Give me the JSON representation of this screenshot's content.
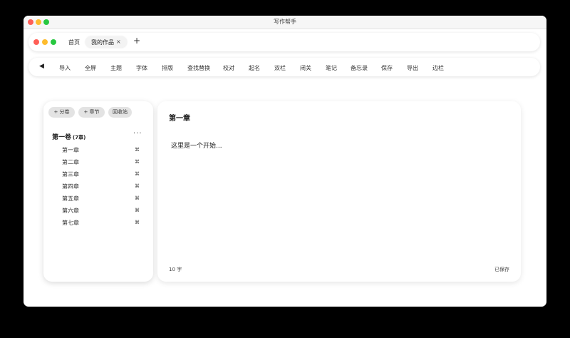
{
  "window": {
    "title": "写作帮手"
  },
  "tabs": {
    "home": "首页",
    "active": "我的作品",
    "close": "×",
    "add": "+"
  },
  "toolbar": {
    "back": "◀",
    "items": [
      "导入",
      "全屏",
      "主题",
      "字体",
      "排版",
      "查找替换",
      "校对",
      "起名",
      "双栏",
      "闭关",
      "笔记",
      "备忘录",
      "保存",
      "导出",
      "边栏"
    ]
  },
  "sidebar": {
    "buttons": {
      "add_volume": "+ 分卷",
      "add_chapter": "+ 章节",
      "recycle": "回收站"
    },
    "volume": {
      "title": "第一卷",
      "count": "(7章)",
      "more": "···"
    },
    "chapters": [
      "第一章",
      "第二章",
      "第三章",
      "第四章",
      "第五章",
      "第六章",
      "第七章"
    ],
    "chapter_key": "⌘"
  },
  "editor": {
    "chapter_title": "第一章",
    "body": "这里是一个开始...",
    "word_count": "10 字",
    "save_status": "已保存"
  },
  "colors": {
    "close_dot": "#ff5f57",
    "minimize_dot": "#febc2e",
    "zoom_dot": "#28c840",
    "pill_bg": "#e3e3e3"
  }
}
